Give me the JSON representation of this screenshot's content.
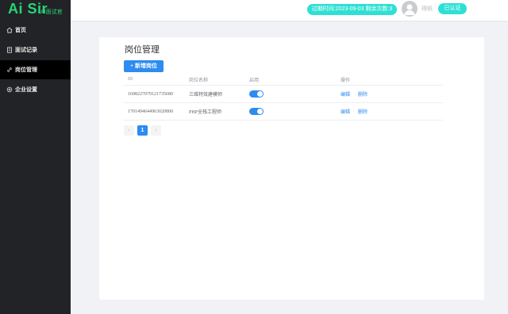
{
  "logo": {
    "main": "Ai Sir",
    "sub": "AI面试官"
  },
  "sidebar": {
    "items": [
      {
        "label": "首页",
        "icon": "home-icon",
        "active": false
      },
      {
        "label": "面试记录",
        "icon": "document-icon",
        "active": false
      },
      {
        "label": "岗位管理",
        "icon": "link-icon",
        "active": true
      },
      {
        "label": "企业设置",
        "icon": "gear-icon",
        "active": false
      }
    ]
  },
  "header": {
    "expire_text": "过期时间:2023-09-03 剩余次数:3",
    "user_name": "得帆",
    "verified_label": "已认证",
    "accent_color": "#2ee0d4"
  },
  "main": {
    "title": "岗位管理",
    "add_button_label": "新增岗位",
    "columns": [
      "ID",
      "岗位名称",
      "启用",
      "操作"
    ],
    "rows": [
      {
        "id": "1698227079121735680",
        "name": "三维特效建模师",
        "enabled": true,
        "edit": "编辑",
        "delete": "删除"
      },
      {
        "id": "1701494644963020800",
        "name": "PHP全栈工程师",
        "enabled": true,
        "edit": "编辑",
        "delete": "删除"
      }
    ],
    "pagination": {
      "prev": "‹",
      "current": "1",
      "next": "›"
    },
    "accent_color": "#2d8cf0"
  }
}
